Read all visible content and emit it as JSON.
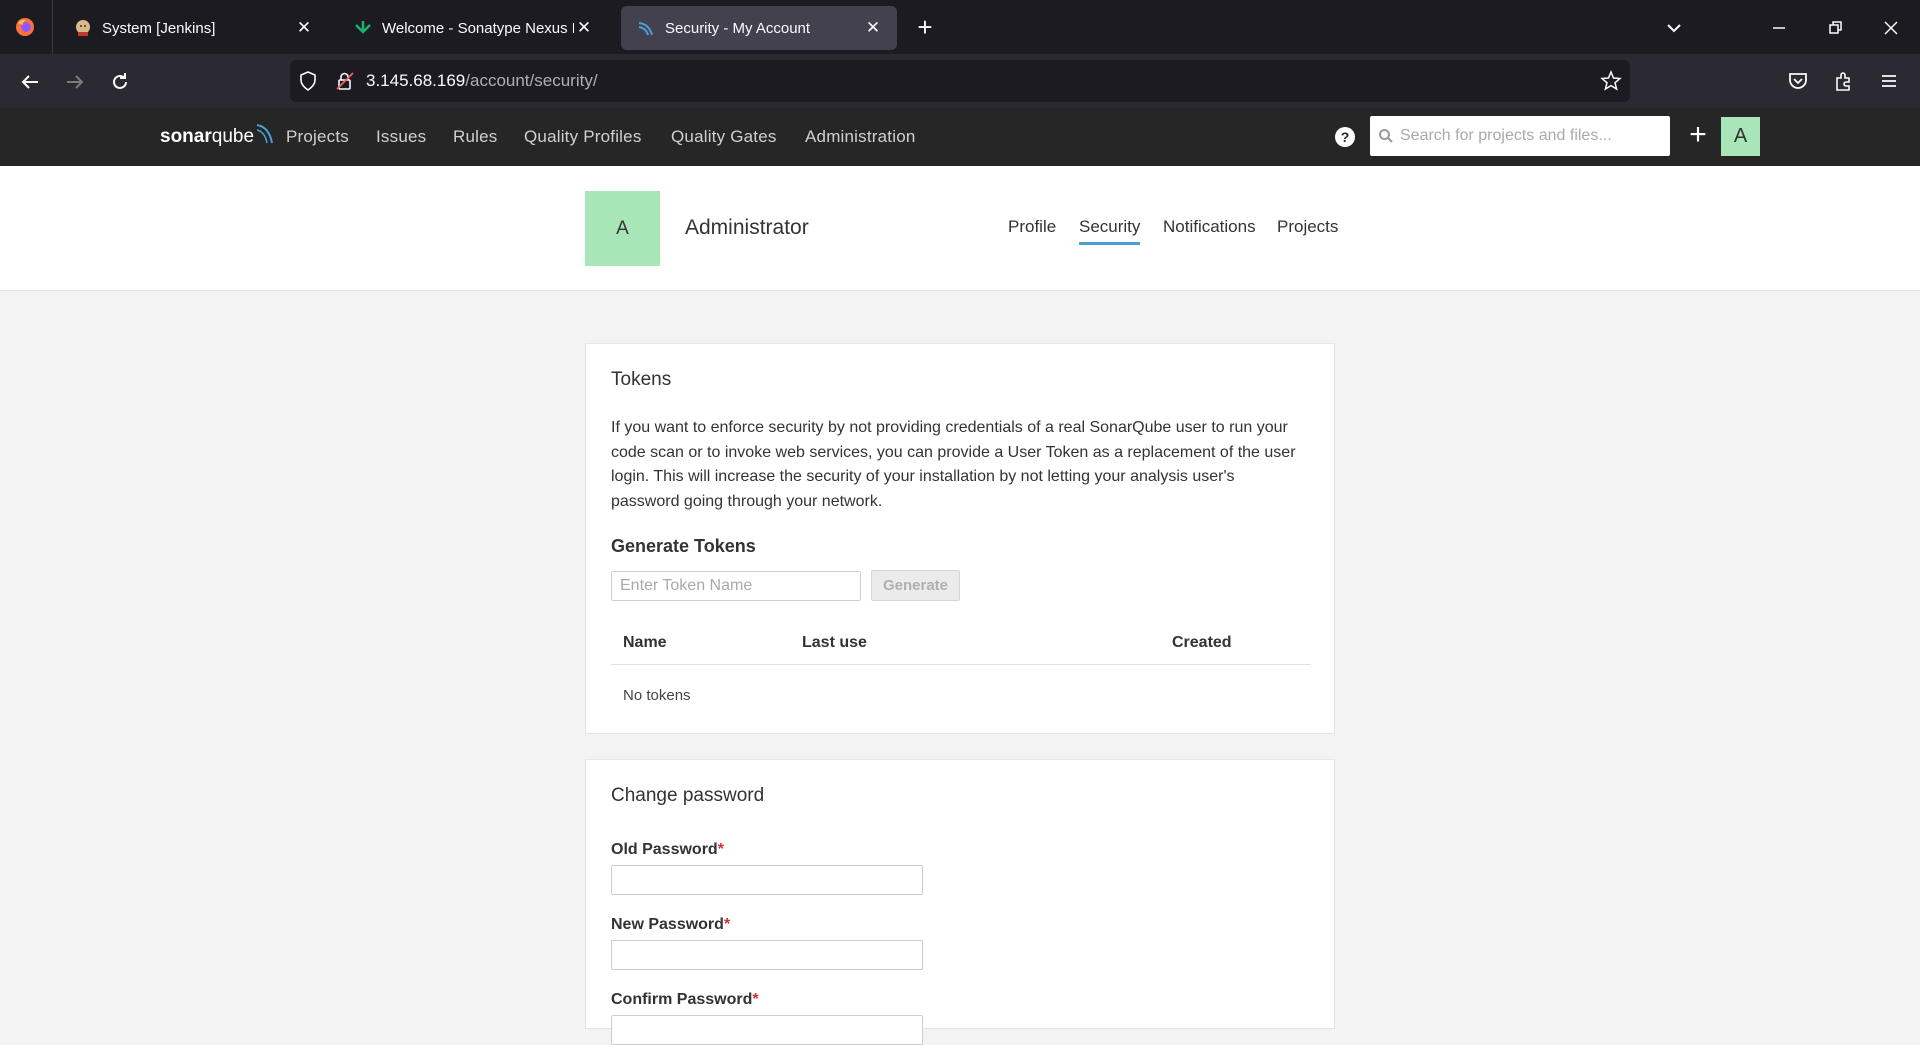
{
  "browser": {
    "tabs": [
      {
        "title": "System [Jenkins]",
        "icon": "jenkins-icon",
        "active": false
      },
      {
        "title": "Welcome - Sonatype Nexus Repository Manager",
        "icon": "nexus-icon",
        "active": false
      },
      {
        "title": "Security - My Account",
        "icon": "sonarqube-icon",
        "active": true
      }
    ],
    "url_host": "3.145.68.169",
    "url_path": "/account/security/"
  },
  "sonar": {
    "logo_bold": "sonar",
    "logo_light": "qube",
    "nav": [
      "Projects",
      "Issues",
      "Rules",
      "Quality Profiles",
      "Quality Gates",
      "Administration"
    ],
    "help_symbol": "?",
    "search_placeholder": "Search for projects and files...",
    "plus_symbol": "+",
    "avatar_letter": "A"
  },
  "account": {
    "avatar_letter": "A",
    "name": "Administrator",
    "tabs": [
      "Profile",
      "Security",
      "Notifications",
      "Projects"
    ],
    "active_tab": "Security"
  },
  "tokens": {
    "title": "Tokens",
    "description": "If you want to enforce security by not providing credentials of a real SonarQube user to run your code scan or to invoke web services, you can provide a User Token as a replacement of the user login. This will increase the security of your installation by not letting your analysis user's password going through your network.",
    "generate_title": "Generate Tokens",
    "token_name_placeholder": "Enter Token Name",
    "generate_label": "Generate",
    "columns": [
      "Name",
      "Last use",
      "Created"
    ],
    "empty_text": "No tokens"
  },
  "password": {
    "title": "Change password",
    "old_label": "Old Password",
    "new_label": "New Password",
    "confirm_label": "Confirm Password",
    "required_mark": "*"
  },
  "colors": {
    "sonar_header": "#262626",
    "avatar_green": "#a8e6b8",
    "active_tab_underline": "#4b9fd5",
    "required": "#d02f3a"
  }
}
